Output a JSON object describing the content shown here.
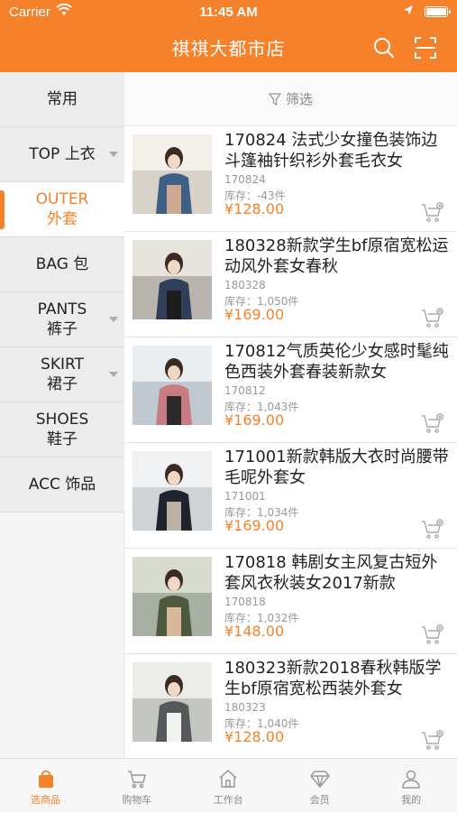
{
  "status_bar": {
    "carrier": "Carrier",
    "time": "11:45 AM"
  },
  "header": {
    "title": "祺祺大都市店",
    "icons": [
      "search-icon",
      "scan-icon"
    ]
  },
  "filter": {
    "label": "筛选"
  },
  "categories": [
    {
      "label": "常用",
      "active": false,
      "has_arrow": false
    },
    {
      "label": "TOP 上衣",
      "active": false,
      "has_arrow": true
    },
    {
      "label": "OUTER\n外套",
      "active": true,
      "has_arrow": false
    },
    {
      "label": "BAG 包",
      "active": false,
      "has_arrow": false
    },
    {
      "label": "PANTS\n裤子",
      "active": false,
      "has_arrow": true
    },
    {
      "label": "SKIRT\n裙子",
      "active": false,
      "has_arrow": true
    },
    {
      "label": "SHOES\n鞋子",
      "active": false,
      "has_arrow": false
    },
    {
      "label": "ACC 饰品",
      "active": false,
      "has_arrow": false
    }
  ],
  "products": [
    {
      "name": "170824 法式少女撞色装饰边斗篷袖针织衫外套毛衣女",
      "code": "170824",
      "stock": "库存：-43件",
      "price": "¥128.00"
    },
    {
      "name": "180328新款学生bf原宿宽松运动风外套女春秋",
      "code": "180328",
      "stock": "库存：1,050件",
      "price": "¥169.00"
    },
    {
      "name": "170812气质英伦少女感时髦纯色西装外套春装新款女",
      "code": "170812",
      "stock": "库存：1,043件",
      "price": "¥169.00"
    },
    {
      "name": "171001新款韩版大衣时尚腰带毛呢外套女",
      "code": "171001",
      "stock": "库存：1,034件",
      "price": "¥169.00"
    },
    {
      "name": "170818 韩剧女主风复古短外套风衣秋装女2017新款",
      "code": "170818",
      "stock": "库存：1,032件",
      "price": "¥148.00"
    },
    {
      "name": "180323新款2018春秋韩版学生bf原宿宽松西装外套女",
      "code": "180323",
      "stock": "库存：1,040件",
      "price": "¥128.00"
    }
  ],
  "tabbar": [
    {
      "label": "选商品",
      "icon": "bag-icon",
      "active": true
    },
    {
      "label": "购物车",
      "icon": "cart-icon",
      "active": false
    },
    {
      "label": "工作台",
      "icon": "home-icon",
      "active": false
    },
    {
      "label": "会员",
      "icon": "diamond-icon",
      "active": false
    },
    {
      "label": "我的",
      "icon": "person-icon",
      "active": false
    }
  ],
  "colors": {
    "accent": "#f5822a",
    "sidebar_bg": "#ececec",
    "text": "#222222",
    "muted": "#999999"
  }
}
